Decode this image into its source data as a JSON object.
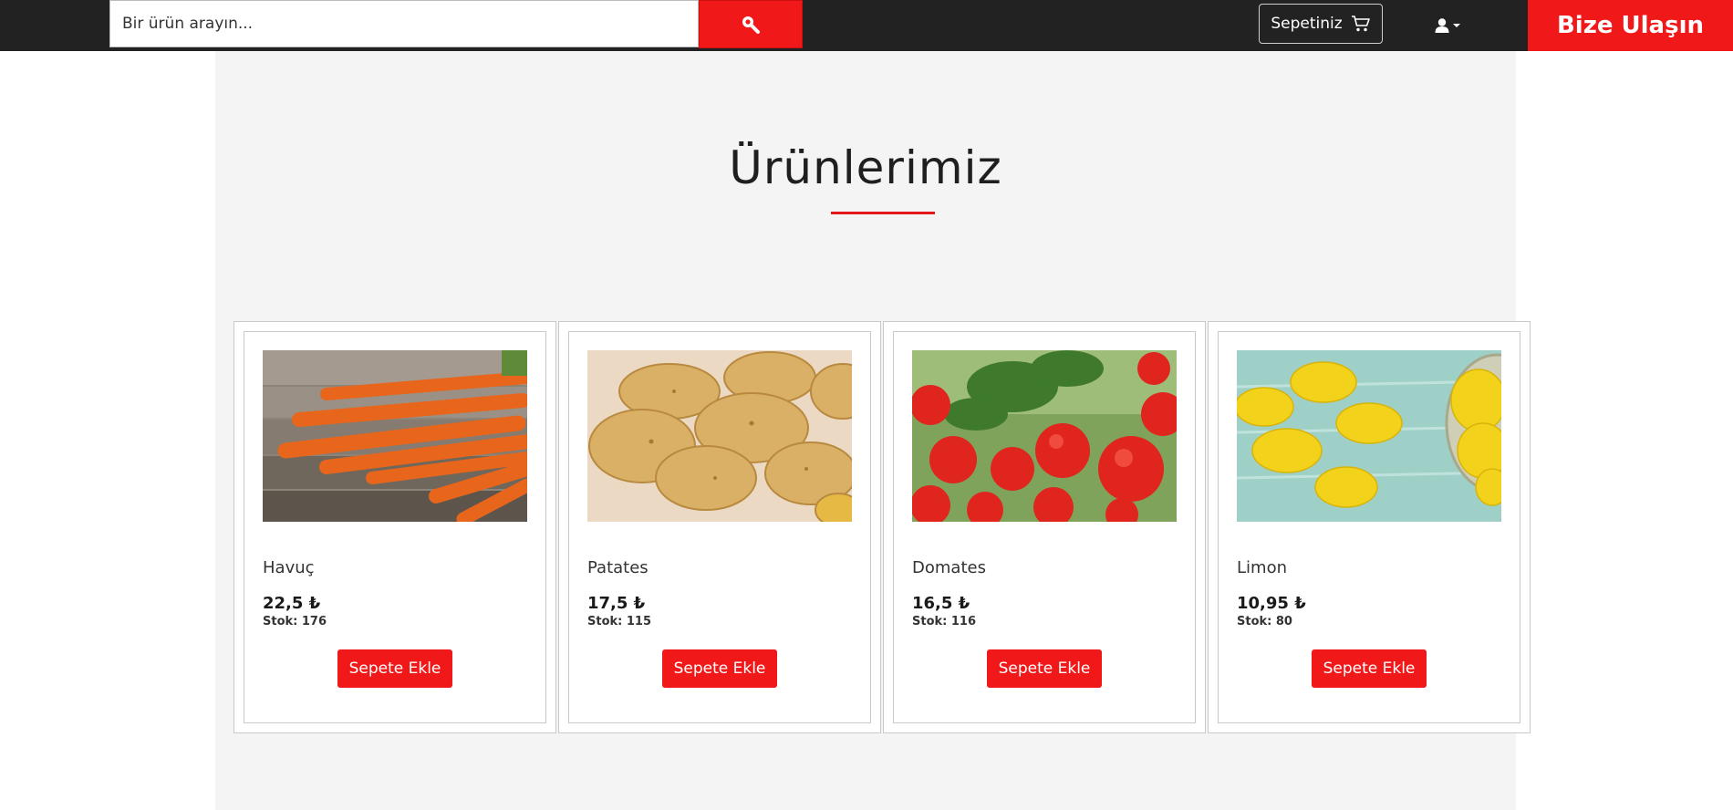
{
  "header": {
    "search_placeholder": "Bir ürün arayın...",
    "search_icon": "search-icon",
    "cart_label": "Sepetiniz",
    "cart_icon": "cart-icon",
    "user_icon": "user-icon",
    "contact_label": "Bize Ulaşın"
  },
  "main": {
    "title": "Ürünlerimiz"
  },
  "products": [
    {
      "name": "Havuç",
      "price": "22,5 ₺",
      "stock": "Stok: 176",
      "button": "Sepete Ekle",
      "image_icon": "carrot-image"
    },
    {
      "name": "Patates",
      "price": "17,5 ₺",
      "stock": "Stok: 115",
      "button": "Sepete Ekle",
      "image_icon": "potato-image"
    },
    {
      "name": "Domates",
      "price": "16,5 ₺",
      "stock": "Stok: 116",
      "button": "Sepete Ekle",
      "image_icon": "tomato-image"
    },
    {
      "name": "Limon",
      "price": "10,95 ₺",
      "stock": "Stok: 80",
      "button": "Sepete Ekle",
      "image_icon": "lemon-image"
    }
  ],
  "colors": {
    "topbar": "#222222",
    "accent": "#f01818",
    "panel": "#f4f4f4"
  }
}
